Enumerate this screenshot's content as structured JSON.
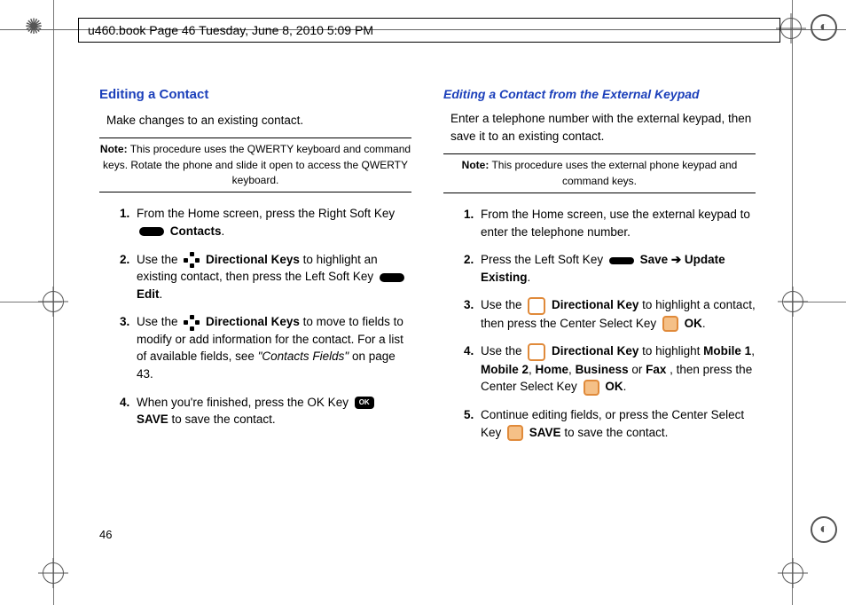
{
  "header": {
    "text": "u460.book  Page 46  Tuesday, June 8, 2010  5:09 PM"
  },
  "page_number": "46",
  "left": {
    "heading": "Editing a Contact",
    "intro": "Make changes to an existing contact.",
    "note_label": "Note:",
    "note_text": " This procedure uses the QWERTY keyboard and command keys. Rotate the phone and slide it open to access the QWERTY keyboard.",
    "s1a": "From the Home screen, press the Right Soft Key ",
    "s1b": " Contacts",
    "s1c": ".",
    "s2a": "Use the ",
    "s2b": " Directional Keys",
    "s2c": " to highlight an existing contact, then press the Left Soft Key ",
    "s2d": " Edit",
    "s2e": ".",
    "s3a": "Use the ",
    "s3b": " Directional Keys",
    "s3c": " to move to fields to modify or add information for the contact. For a list of available fields, see ",
    "s3d": "\"Contacts Fields\"",
    "s3e": " on page 43.",
    "s4a": "When you're finished, press the OK Key ",
    "s4b": " SAVE",
    "s4c": " to save the contact.",
    "ok_label": "OK"
  },
  "right": {
    "heading": "Editing a Contact from the External Keypad",
    "intro": "Enter a telephone number with the external keypad, then save it to an existing contact.",
    "note_label": "Note:",
    "note_text": " This procedure uses the external phone keypad and command keys.",
    "s1": "From the Home screen, use the external keypad to enter the telephone number.",
    "s2a": "Press the Left Soft Key ",
    "s2b": " Save ➔ Update Existing",
    "s2c": ".",
    "s3a": "Use the ",
    "s3b": " Directional Key",
    "s3c": " to highlight a contact, then press the Center Select Key ",
    "s3d": " OK",
    "s3e": ".",
    "s4a": "Use the ",
    "s4b": " Directional Key",
    "s4c": " to highlight ",
    "s4d": "Mobile 1",
    "s4e": ", ",
    "s4f": "Mobile 2",
    "s4g": ", ",
    "s4h": "Home",
    "s4i": ", ",
    "s4j": "Business",
    "s4k": " or ",
    "s4l": "Fax",
    "s4m": ", then press the Center Select Key ",
    "s4n": " OK",
    "s4o": ".",
    "s5a": "Continue editing fields, or press the Center Select Key ",
    "s5b": " SAVE",
    "s5c": " to save the contact."
  }
}
